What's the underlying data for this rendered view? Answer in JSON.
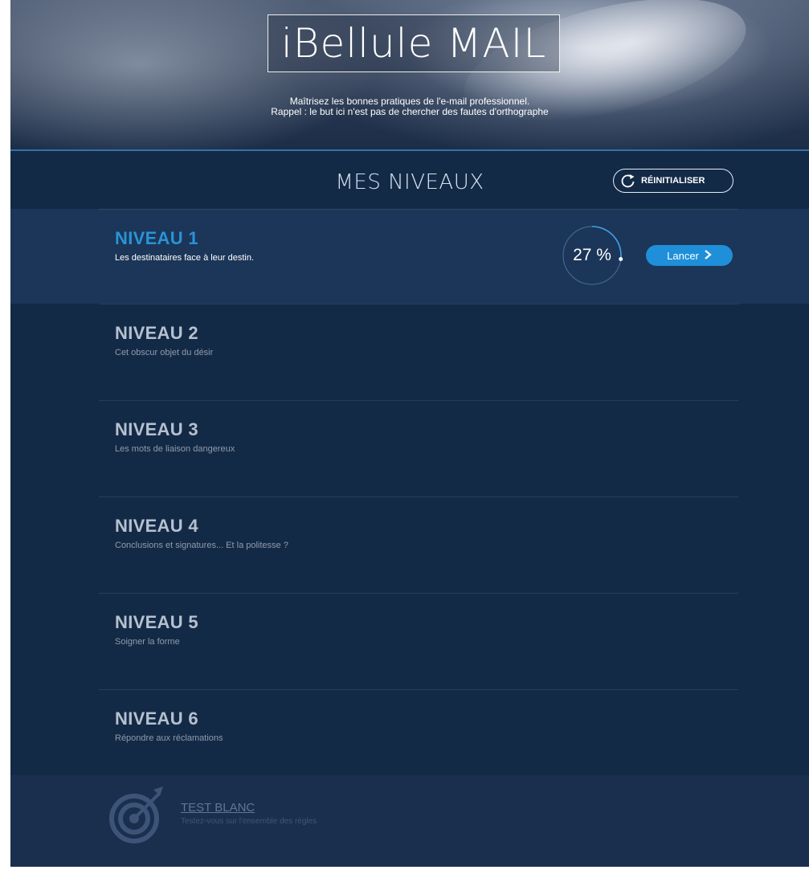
{
  "header": {
    "logo": "iBellule MAIL",
    "tagline_line1": "Maîtrisez les bonnes pratiques de l'e-mail professionnel.",
    "tagline_line2": "Rappel : le but ici n'est pas de chercher des fautes d'orthographe"
  },
  "title": "MES NIVEAUX",
  "reset_button": {
    "label": "RÉINITIALISER",
    "icon": "reset-icon"
  },
  "levels": [
    {
      "name": "NIVEAU 1",
      "desc": "Les destinataires face à leur destin.",
      "active": true,
      "progress": 27,
      "progress_label": "27 %",
      "launch_label": "Lancer",
      "launch_icon": "chevron-right-icon"
    },
    {
      "name": "NIVEAU 2",
      "desc": "Cet obscur objet du désir"
    },
    {
      "name": "NIVEAU 3",
      "desc": "Les mots de liaison dangereux"
    },
    {
      "name": "NIVEAU 4",
      "desc": "Conclusions et signatures... Et la politesse ?"
    },
    {
      "name": "NIVEAU 5",
      "desc": "Soigner la forme"
    },
    {
      "name": "NIVEAU 6",
      "desc": "Répondre aux réclamations"
    }
  ],
  "footer": {
    "icon": "target-icon",
    "test_label": "TEST BLANC",
    "test_desc": "Testez-vous sur l'ensemble des règles"
  },
  "colors": {
    "background": "#132a47",
    "active_row": "#1b3658",
    "accent": "#1e8fd8",
    "active_title": "#2a93d6"
  }
}
